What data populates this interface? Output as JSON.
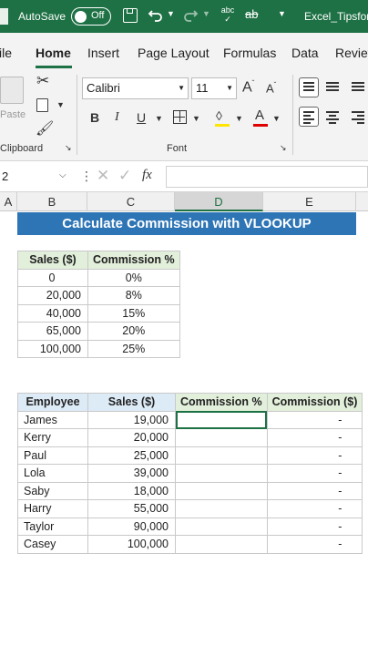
{
  "titlebar": {
    "autosave_label": "AutoSave",
    "toggle_state": "Off",
    "filename": "Excel_Tipsfor",
    "bg_color": "#1e7145"
  },
  "tabs": [
    "ile",
    "Home",
    "Insert",
    "Page Layout",
    "Formulas",
    "Data",
    "Review"
  ],
  "active_tab": "Home",
  "ribbon": {
    "paste_label": "Paste",
    "clipboard_label": "Clipboard",
    "font_label": "Font",
    "font_name": "Calibri",
    "font_size": "11",
    "bold": "B",
    "italic": "I",
    "underline": "U",
    "grow_font": "A",
    "shrink_font": "A",
    "font_color_letter": "A"
  },
  "formula_bar": {
    "name_box": "2",
    "fx": "fx",
    "value": ""
  },
  "columns": [
    "A",
    "B",
    "C",
    "D",
    "E"
  ],
  "selected_column": "D",
  "sheet": {
    "banner": "Calculate Commission with VLOOKUP",
    "banner_color": "#2e75b6",
    "rate_table": {
      "headers": [
        "Sales ($)",
        "Commission %"
      ],
      "rows": [
        [
          "0",
          "0%"
        ],
        [
          "20,000",
          "8%"
        ],
        [
          "40,000",
          "15%"
        ],
        [
          "65,000",
          "20%"
        ],
        [
          "100,000",
          "25%"
        ]
      ]
    },
    "employee_table": {
      "headers": [
        "Employee",
        "Sales ($)",
        "Commission %",
        "Commission ($)"
      ],
      "rows": [
        [
          "James",
          "19,000",
          "",
          "-"
        ],
        [
          "Kerry",
          "20,000",
          "",
          "-"
        ],
        [
          "Paul",
          "25,000",
          "",
          "-"
        ],
        [
          "Lola",
          "39,000",
          "",
          "-"
        ],
        [
          "Saby",
          "18,000",
          "",
          "-"
        ],
        [
          "Harry",
          "55,000",
          "",
          "-"
        ],
        [
          "Taylor",
          "90,000",
          "",
          "-"
        ],
        [
          "Casey",
          "100,000",
          "",
          "-"
        ]
      ]
    }
  }
}
